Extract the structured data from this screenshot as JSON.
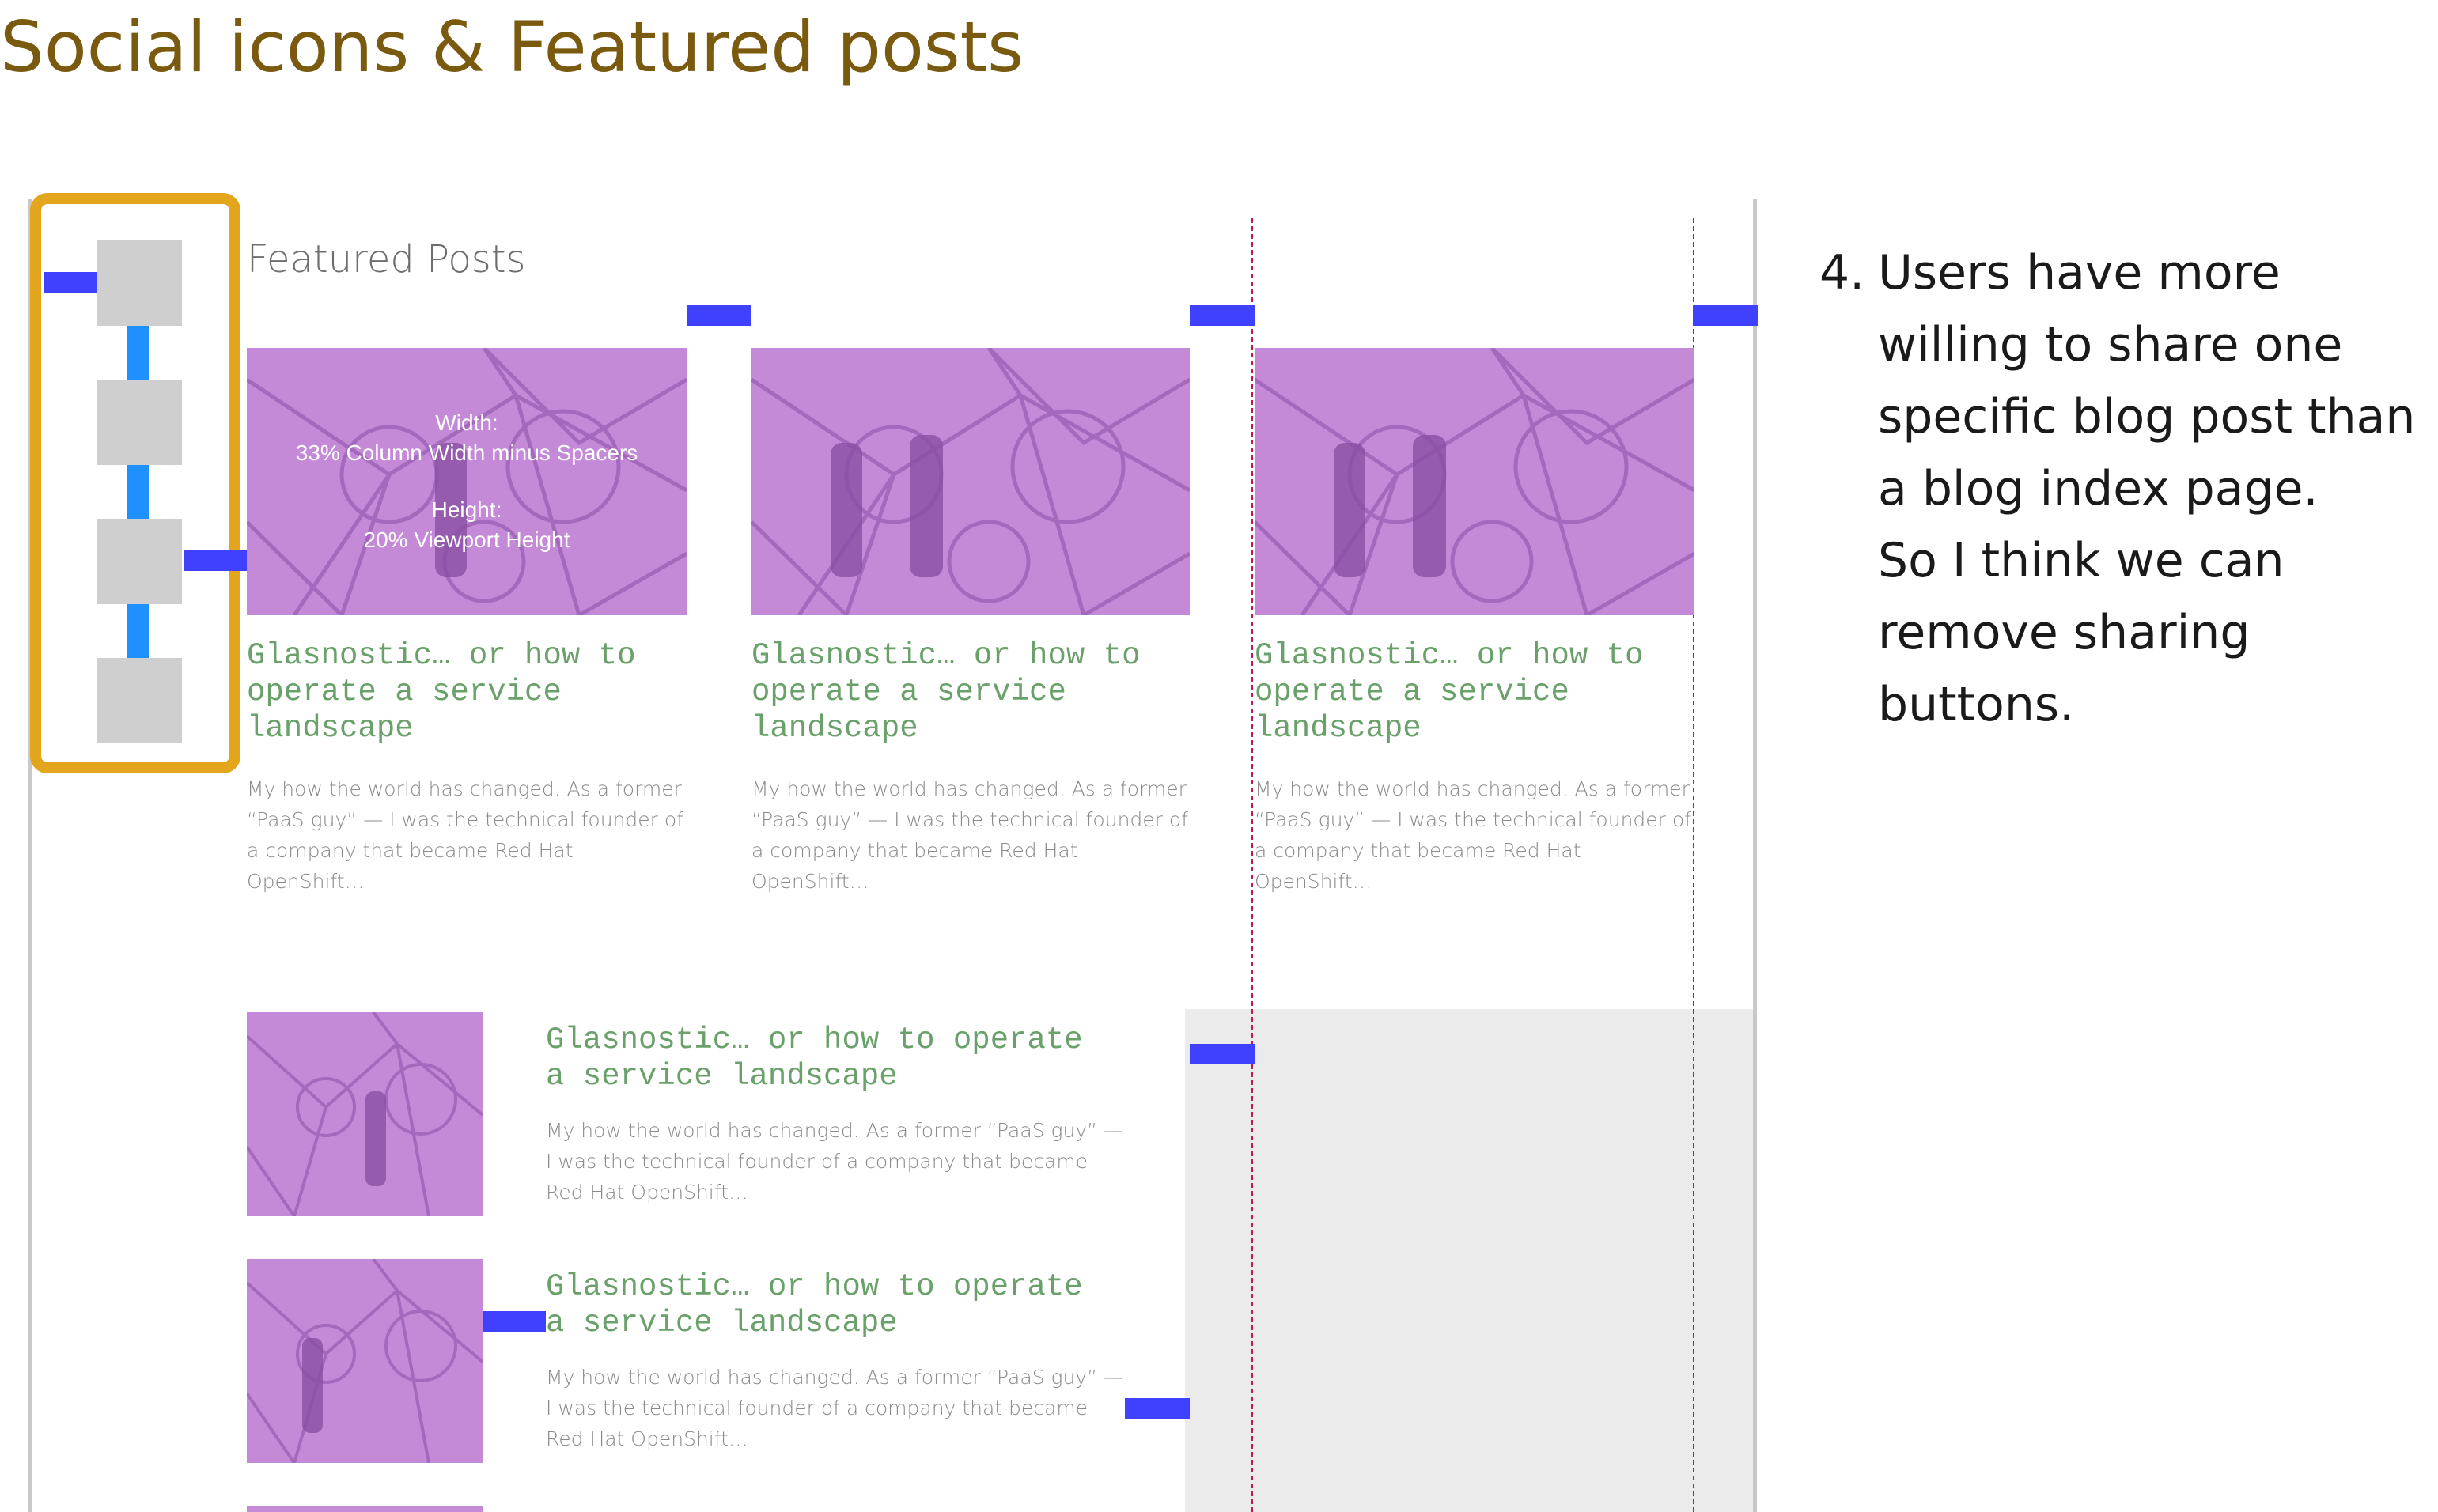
{
  "page": {
    "title": "Social icons & Featured posts"
  },
  "section": {
    "heading": "Featured Posts"
  },
  "colors": {
    "accent_title": "#7a5a0e",
    "highlight_border": "#e2a51b",
    "spacer": "#4040ff",
    "connector": "#1e90ff",
    "post_title": "#6aa16a",
    "thumbnail_tint": "#c48ad8",
    "guide_line": "#c2185b"
  },
  "annotation": {
    "width_label": "Width:",
    "width_value": "33% Column Width minus Spacers",
    "height_label": "Height:",
    "height_value": "20% Viewport Height"
  },
  "featured_posts": [
    {
      "title": "Glasnostic… or how to\noperate a service\nlandscape",
      "excerpt": "My how the world has changed. As a former “PaaS guy” — I was the technical founder of a company that became Red Hat OpenShift…"
    },
    {
      "title": "Glasnostic… or how to\noperate a service\nlandscape",
      "excerpt": "My how the world has changed. As a former “PaaS guy” — I was the technical founder of a company that became Red Hat OpenShift…"
    },
    {
      "title": "Glasnostic… or how to\noperate a service\nlandscape",
      "excerpt": "My how the world has changed. As a former “PaaS guy” — I was the technical founder of a company that became Red Hat OpenShift…"
    }
  ],
  "list_posts": [
    {
      "title": "Glasnostic… or how to operate\na service landscape",
      "excerpt": "My how the world has changed. As a former “PaaS guy” — I was the technical founder of a company that became Red Hat OpenShift…"
    },
    {
      "title": "Glasnostic… or how to operate\na service landscape",
      "excerpt": "My how the world has changed. As a former “PaaS guy” — I was the technical founder of a company that became Red Hat OpenShift…"
    }
  ],
  "social_icons": [
    "share-icon-1",
    "share-icon-2",
    "share-icon-3",
    "share-icon-4"
  ],
  "note": {
    "number": "4.",
    "text": "Users have more\nwilling to share one\nspecific blog post than\na blog index page.\n So I think we can\nremove sharing\nbuttons."
  }
}
